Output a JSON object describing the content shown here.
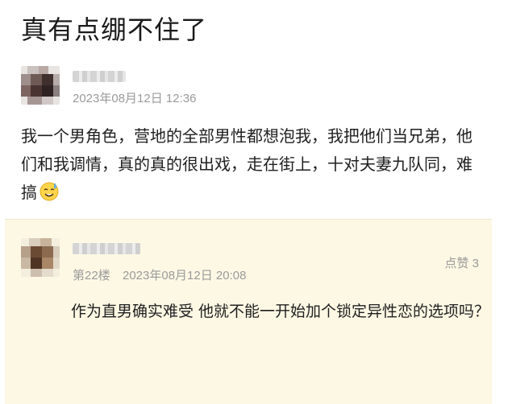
{
  "post": {
    "title": "真有点绷不住了",
    "date": "2023年08月12日 12:36",
    "body": "我一个男角色，营地的全部男性都想泡我，我把他们当兄弟，他们和我调情，真的真的很出戏，走在街上，十对夫妻九队同，难搞"
  },
  "icons": {
    "sweat_emoji": "sweat-smile-icon"
  },
  "reply": {
    "floor": "第22楼",
    "date": "2023年08月12日 20:08",
    "likes": "点赞 3",
    "body": "作为直男确实难受 他就不能一开始加个锁定异性恋的选项吗？"
  },
  "colors": {
    "reply_background": "#fdf8e4",
    "meta_text": "#9a9a9a"
  }
}
